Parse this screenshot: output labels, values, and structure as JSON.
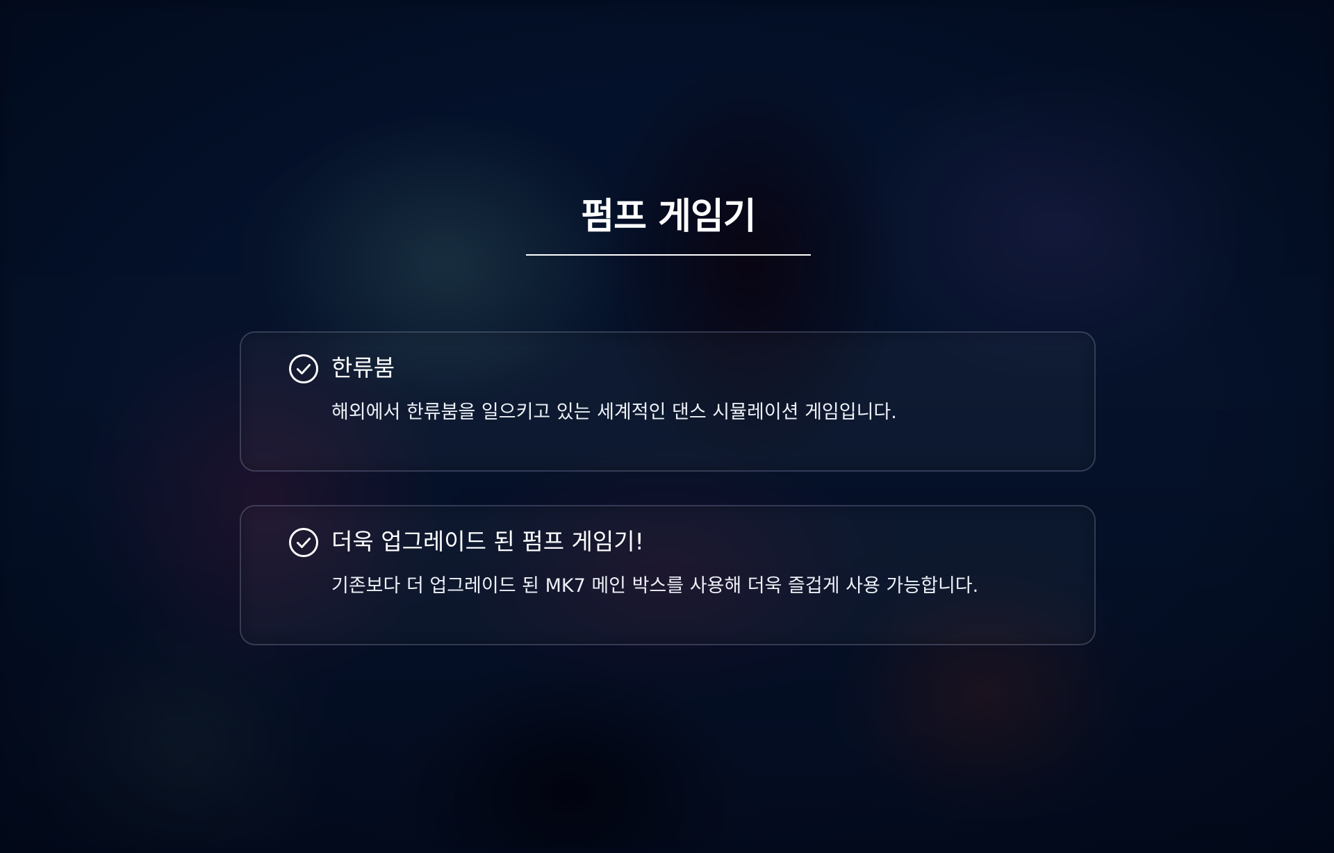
{
  "page": {
    "title": "펌프 게임기"
  },
  "features": [
    {
      "icon": "check-circle-icon",
      "title": "한류붐",
      "description": "해외에서 한류붐을 일으키고 있는 세계적인 댄스 시뮬레이션 게임입니다."
    },
    {
      "icon": "check-circle-icon",
      "title": "더욱 업그레이드 된 펌프 게임기!",
      "description": "기존보다 더 업그레이드 된 MK7 메인 박스를 사용해 더욱 즐겁게 사용 가능합니다."
    }
  ],
  "colors": {
    "background": "#030b1f",
    "text": "#ffffff",
    "card_border": "#4a5270"
  }
}
